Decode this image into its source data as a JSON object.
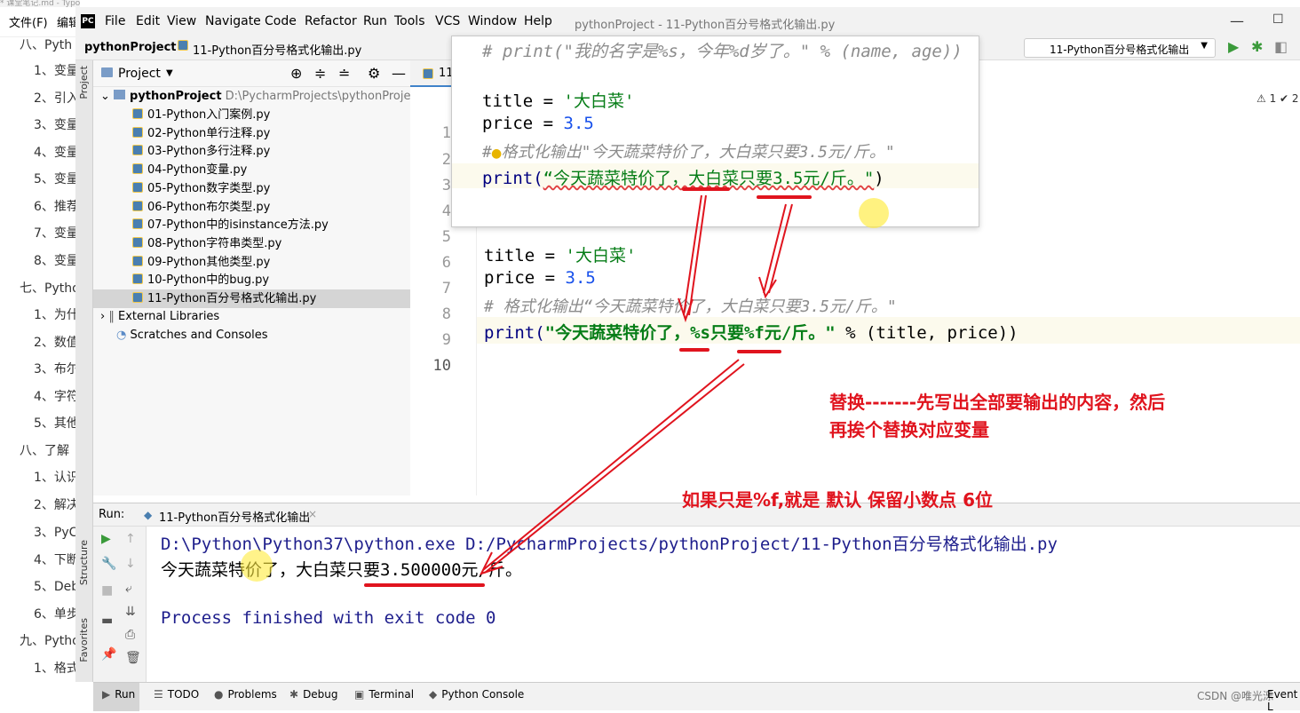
{
  "typora": {
    "title": "* 课堂笔记.md - Typora",
    "menu": [
      "文件(F)",
      "编辑"
    ],
    "outline": [
      "八、Pyth",
      "1、变量",
      "2、引入",
      "3、变量",
      "4、变量",
      "5、变量",
      "6、推荐",
      "7、变量",
      "8、变量",
      "七、Pytho",
      "1、为什",
      "2、数值",
      "3、布尔",
      "4、字符",
      "5、其他",
      "八、了解",
      "1、认识",
      "2、解决",
      "3、PyC",
      "4、下断",
      "5、Deb",
      "6、单步",
      "九、Pytho",
      "1、格式"
    ]
  },
  "pycharm": {
    "menu": [
      "File",
      "Edit",
      "View",
      "Navigate",
      "Code",
      "Refactor",
      "Run",
      "Tools",
      "VCS",
      "Window",
      "Help"
    ],
    "window_title": "pythonProject - 11-Python百分号格式化输出.py",
    "breadcrumb": {
      "project": "pythonProject",
      "file": "11-Python百分号格式化输出.py"
    },
    "run_config": "11-Python百分号格式化输出",
    "left_tabs": [
      "Project",
      "Structure",
      "Favorites"
    ],
    "project_panel": {
      "header": "Project",
      "root": "pythonProject",
      "root_path": "D:\\PycharmProjects\\pythonProject",
      "files": [
        "01-Python入门案例.py",
        "02-Python单行注释.py",
        "03-Python多行注释.py",
        "04-Python变量.py",
        "05-Python数字类型.py",
        "06-Python布尔类型.py",
        "07-Python中的isinstance方法.py",
        "08-Python字符串类型.py",
        "09-Python其他类型.py",
        "10-Python中的bug.py",
        "11-Python百分号格式化输出.py"
      ],
      "external": "External Libraries",
      "scratches": "Scratches and Consoles"
    },
    "editor": {
      "tab": "11",
      "warnings": "⚠ 1  ✔ 2",
      "popup_line": "# print(\"我的名字是%s，今年%d岁了。\" % (name, age))",
      "line_numbers": [
        "1",
        "2",
        "3",
        "4",
        "5",
        "6",
        "7",
        "8",
        "9",
        "10"
      ],
      "l1_var": "title",
      "l1_eq": " = ",
      "l1_str": "'大白菜'",
      "l2_var": "price",
      "l2_eq": " = ",
      "l2_num": "3.5",
      "l3": "# 格式化输出\"今天蔬菜特价了，大白菜只要3.5元/斤。\"",
      "l4_fn": "print(",
      "l4_str": "“今天蔬菜特价了，大白菜只要3.5元/斤。\"",
      "l4_end": ")",
      "l7_var": "title",
      "l7_eq": " = ",
      "l7_str": "'大白菜'",
      "l8_var": "price",
      "l8_eq": " = ",
      "l8_num": "3.5",
      "l9": "# 格式化输出“今天蔬菜特价了，大白菜只要3.5元/斤。\"",
      "l10_fn": "print(",
      "l10_str": "\"今天蔬菜特价了，%s只要%f元/斤。\"",
      "l10_rest": " % (title, price))"
    },
    "run": {
      "label": "Run:",
      "tab": "11-Python百分号格式化输出",
      "cmd": "D:\\Python\\Python37\\python.exe D:/PycharmProjects/pythonProject/11-Python百分号格式化输出.py",
      "output": "今天蔬菜特价了，大白菜只要3.500000元/斤。",
      "exit": "Process finished with exit code 0"
    },
    "bottom_tabs": [
      "Run",
      "TODO",
      "Problems",
      "Debug",
      "Terminal",
      "Python Console"
    ],
    "watermark": "CSDN @唯光泺",
    "event_log": "Event L"
  },
  "annotations": {
    "replace_1": "替换-------先写出全部要输出的内容，然后",
    "replace_2": "再挨个替换对应变量",
    "default_f": "如果只是%f,就是  默认  保留小数点  6位"
  },
  "colors": {
    "annotation": "#e0141e",
    "string": "#067d17",
    "number": "#1750eb",
    "comment": "#8c8c8c"
  }
}
